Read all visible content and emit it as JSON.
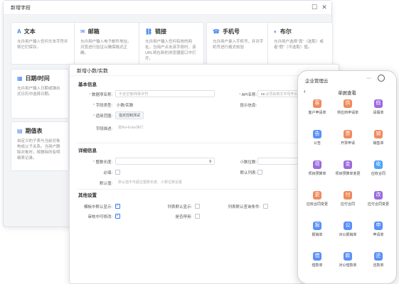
{
  "window1": {
    "title": "新增字段",
    "cards": [
      {
        "title": "文本",
        "icon": "text-icon",
        "glyph": "A",
        "desc": "允许用户输入任何文本字符并将它们保存。"
      },
      {
        "title": "邮箱",
        "icon": "mail-icon",
        "glyph": "✉",
        "desc": "允许用户输入电子邮件地址。对其进行验证以确保格式正确。"
      },
      {
        "title": "链接",
        "icon": "link-icon",
        "glyph": "⛓",
        "desc": "允许用户输入任何有效的网址。当用户点击该字段时，该URL将在新的浏览器窗口中打开。"
      },
      {
        "title": "手机号",
        "icon": "phone-icon",
        "glyph": "☎",
        "desc": "允许用户录入手机号，并对手机号进行格式校验"
      },
      {
        "title": "布尔",
        "icon": "boolean-icon",
        "glyph": "◐",
        "desc": "允许用户选择\"真\"（选取）或者\"假\"（不选取）值。"
      },
      {
        "title": "日期/时间",
        "icon": "calendar-icon",
        "glyph": "▦",
        "desc": "允许用户输入日期或弹出式日历中选择日期。"
      },
      {
        "title": "期值表",
        "icon": "table-icon",
        "glyph": "▤",
        "desc": "自定义的子表与当前对象构成父子关系。当用户删除对象时，将删除所有明细表记录。"
      }
    ]
  },
  "window2": {
    "title": "新增小数/实数",
    "basic_title": "基本信息",
    "labels": {
      "name": "数据项名称:",
      "api": "API名称:",
      "type": "字段类型:",
      "tip": "提示信息:",
      "scope": "适用范围:",
      "desc": "字段描述:",
      "detail_title": "详细信息",
      "length": "整数长度:",
      "decimals": "小数位数:",
      "required": "必填:",
      "default_display": "默认列表:",
      "default_value": "默认值:",
      "other_title": "其他设置",
      "hide_list": "模板中默认显示:",
      "list_default": "列表默认显示:",
      "search_cond": "列表默认查询条件:",
      "audit_edit": "审核中可修改:",
      "enable": "是否停用:"
    },
    "values": {
      "name_placeholder": "不含空格/特殊字符",
      "api_prefix": "cs",
      "api_placeholder": "必须由英文字母开头",
      "type_value": "小数/实数",
      "scope_tag": "指定控制测试",
      "desc_placeholder": "按Alt+Enter换行",
      "length_value": "9",
      "default_placeholder": "默认值不可超过整数长度、小数位数设置"
    }
  },
  "phone": {
    "app_title": "企业管理云",
    "page_title": "单据查看",
    "more_glyph": "···",
    "items": [
      {
        "label": "客户申请单",
        "color": "#f08a5d",
        "glyph": "客"
      },
      {
        "label": "供应商申请单",
        "color": "#f08a5d",
        "glyph": "供"
      },
      {
        "label": "请假单",
        "color": "#9c6ade",
        "glyph": "假"
      },
      {
        "label": "公告",
        "color": "#5b8ff9",
        "glyph": "告"
      },
      {
        "label": "开票申请",
        "color": "#f08a5d",
        "glyph": "票"
      },
      {
        "label": "销售单",
        "color": "#f08a5d",
        "glyph": "销"
      },
      {
        "label": "项目预算单",
        "color": "#9c6ade",
        "glyph": "项"
      },
      {
        "label": "项目预算单变更",
        "color": "#9c6ade",
        "glyph": "变"
      },
      {
        "label": "应收合同",
        "color": "#4fa3f7",
        "glyph": "收"
      },
      {
        "label": "应收合同变更",
        "color": "#f08a5d",
        "glyph": "更"
      },
      {
        "label": "应付合同",
        "color": "#f08a5d",
        "glyph": "付"
      },
      {
        "label": "应付合同变更",
        "color": "#9c6ade",
        "glyph": "改"
      },
      {
        "label": "报销单",
        "color": "#5b8ff9",
        "glyph": "报"
      },
      {
        "label": "对公报销单",
        "color": "#5b8ff9",
        "glyph": "公"
      },
      {
        "label": "申请单",
        "color": "#5b8ff9",
        "glyph": "申"
      },
      {
        "label": "借款单",
        "color": "#5b8ff9",
        "glyph": "借"
      },
      {
        "label": "对公借款单",
        "color": "#5b8ff9",
        "glyph": "款"
      },
      {
        "label": "还款单",
        "color": "#5b8ff9",
        "glyph": "还"
      }
    ]
  }
}
